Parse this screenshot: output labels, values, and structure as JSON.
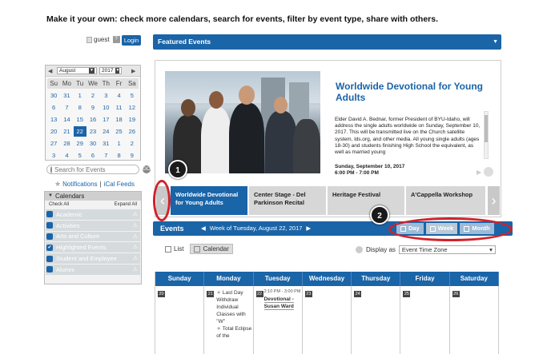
{
  "heading": "Make it your own:  check more calendars, search for events, filter by event type, share with others.",
  "login": {
    "guest_label": "guest",
    "guest_btn": "?",
    "login_label": "Login"
  },
  "mini_calendar": {
    "prev": "◀",
    "next": "▶",
    "month": "August",
    "year": "2017",
    "dows": [
      "Su",
      "Mo",
      "Tu",
      "We",
      "Th",
      "Fr",
      "Sa"
    ],
    "weeks": [
      [
        "30",
        "31",
        "1",
        "2",
        "3",
        "4",
        "5"
      ],
      [
        "6",
        "7",
        "8",
        "9",
        "10",
        "11",
        "12"
      ],
      [
        "13",
        "14",
        "15",
        "16",
        "17",
        "18",
        "19"
      ],
      [
        "20",
        "21",
        "22",
        "23",
        "24",
        "25",
        "26"
      ],
      [
        "27",
        "28",
        "29",
        "30",
        "31",
        "1",
        "2"
      ],
      [
        "3",
        "4",
        "5",
        "6",
        "7",
        "8",
        "9"
      ]
    ],
    "selected_day": "22"
  },
  "search": {
    "placeholder": "Search for Events",
    "go_label": "GO"
  },
  "feeds": {
    "notifications": "Notifications",
    "ical": "iCal Feeds"
  },
  "calendars": {
    "title": "Calendars",
    "check_all": "Check All",
    "expand_all": "Expand All",
    "items": [
      {
        "label": "Academic",
        "checked": false
      },
      {
        "label": "Activities",
        "checked": false
      },
      {
        "label": "Arts and Culture",
        "checked": false
      },
      {
        "label": "Highlighted Events",
        "checked": true
      },
      {
        "label": "Student and Employee",
        "checked": false
      },
      {
        "label": "Alumni",
        "checked": false
      }
    ]
  },
  "featured": {
    "bar_title": "Featured Events",
    "title": "Worldwide Devotional for Young Adults",
    "description": "Elder David A. Bednar, former President of BYU-Idaho, will address the single adults worldwide on Sunday, September 10, 2017. This will be transmitted live on the Church satellite system, lds.org, and other media. All young single adults (ages 18-30) and students finishing High School the equivalent, as well as married young",
    "date": "Sunday, September 10, 2017",
    "time": "6:00 PM - 7:00 PM",
    "carousel": [
      {
        "label": "Worldwide Devotional for Young Adults",
        "active": true
      },
      {
        "label": "Center Stage - Del Parkinson Recital",
        "active": false
      },
      {
        "label": "Heritage Festival",
        "active": false
      },
      {
        "label": "A'Cappella Workshop",
        "active": false
      }
    ]
  },
  "events": {
    "title": "Events",
    "week_label": "Week of Tuesday, August 22, 2017",
    "views": [
      {
        "label": "Day",
        "active": false
      },
      {
        "label": "Week",
        "active": true
      },
      {
        "label": "Month",
        "active": false
      }
    ],
    "list_label": "List",
    "calendar_label": "Calendar",
    "display_as": "Display as",
    "timezone": "Event Time Zone"
  },
  "week": {
    "days": [
      "Sunday",
      "Monday",
      "Tuesday",
      "Wednesday",
      "Thursday",
      "Friday",
      "Saturday"
    ],
    "dates": [
      "20",
      "21",
      "22",
      "23",
      "24",
      "25",
      "26"
    ],
    "monday_events": [
      "Last Day Withdraw Individual Classes with \"W\"",
      "Total Eclipse of the"
    ],
    "tuesday_event": {
      "time": "2:10 PM - 3:00 PM",
      "title": "Devotional - Susan Ward"
    }
  },
  "callouts": [
    "1",
    "2"
  ],
  "colors": {
    "primary": "#1a64a8",
    "callout_red": "#d0212b",
    "inactive_view": "#9dbbd8"
  }
}
